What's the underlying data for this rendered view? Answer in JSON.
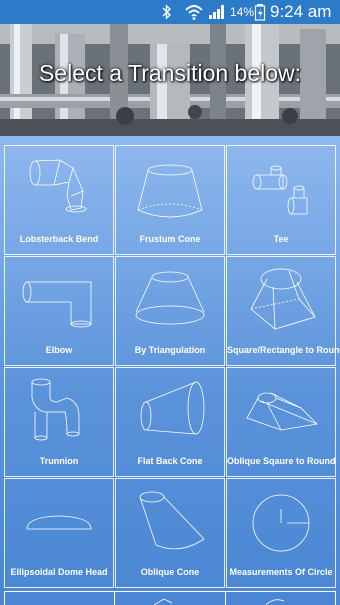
{
  "status_bar": {
    "battery_percent": "14%",
    "time": "9:24 am",
    "icons": [
      "bluetooth-icon",
      "wifi-icon",
      "signal-icon",
      "battery-charging-icon"
    ]
  },
  "header": {
    "title": "Select a Transition below:"
  },
  "transitions": [
    {
      "label": "Lobsterback Bend",
      "icon": "lobsterback-bend-icon"
    },
    {
      "label": "Frustum Cone",
      "icon": "frustum-cone-icon"
    },
    {
      "label": "Tee",
      "icon": "tee-icon"
    },
    {
      "label": "Elbow",
      "icon": "elbow-icon"
    },
    {
      "label": "By Triangulation",
      "icon": "triangulation-icon"
    },
    {
      "label": "Square/Rectangle to Round",
      "icon": "square-to-round-icon"
    },
    {
      "label": "Trunnion",
      "icon": "trunnion-icon"
    },
    {
      "label": "Flat Back Cone",
      "icon": "flat-back-cone-icon"
    },
    {
      "label": "Oblique Sqaure to Round",
      "icon": "oblique-square-to-round-icon"
    },
    {
      "label": "Ellipsoidal Dome Head",
      "icon": "ellipsoidal-dome-head-icon"
    },
    {
      "label": "Oblique Cone",
      "icon": "oblique-cone-icon"
    },
    {
      "label": "Measurements Of Circle",
      "icon": "circle-measurements-icon"
    }
  ]
}
